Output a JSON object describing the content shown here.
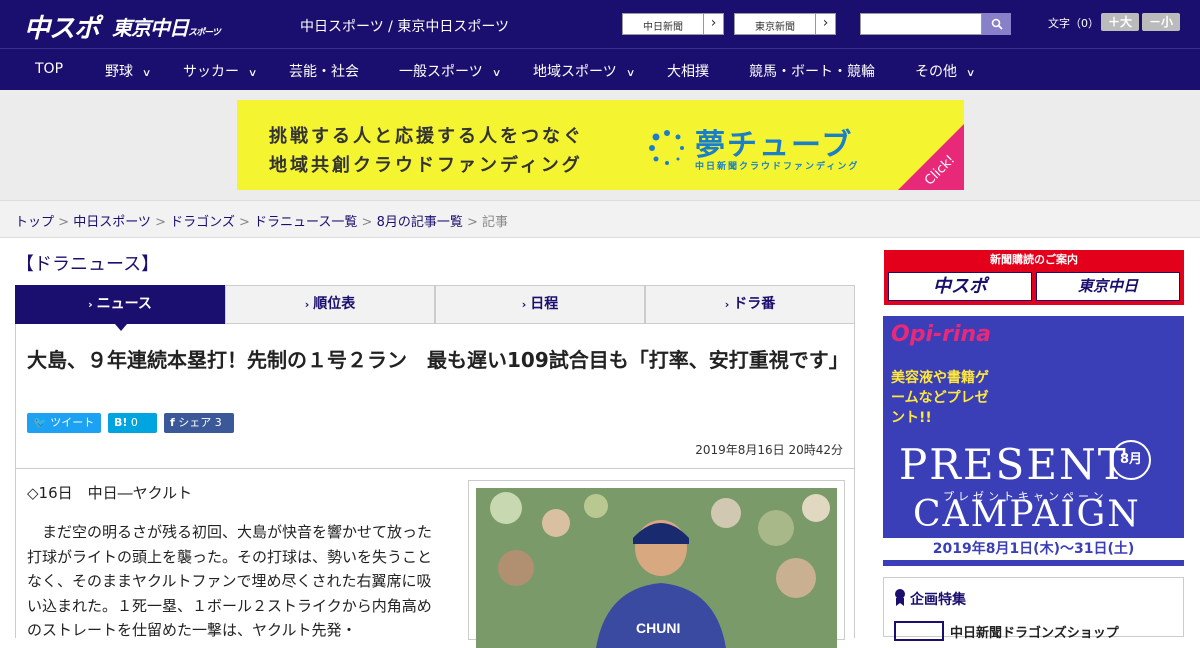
{
  "header": {
    "logo_chuspo": "中スポ",
    "logo_tokyo": "東京中日",
    "logo_tokyo_small": "スポーツ",
    "site_links": "中日スポーツ / 東京中日スポーツ",
    "paper_btn_1": "中日新聞",
    "paper_btn_2": "東京新聞",
    "search_placeholder": "",
    "font_label": "文字（0）",
    "font_plus": "＋大",
    "font_minus": "－小"
  },
  "nav": {
    "items": [
      {
        "label": "TOP"
      },
      {
        "label": "野球"
      },
      {
        "label": "サッカー"
      },
      {
        "label": "芸能・社会"
      },
      {
        "label": "一般スポーツ"
      },
      {
        "label": "地域スポーツ"
      },
      {
        "label": "大相撲"
      },
      {
        "label": "競馬・ボート・競輪"
      },
      {
        "label": "その他"
      }
    ]
  },
  "ad": {
    "line1": "挑戦する人と応援する人をつなぐ",
    "line2": "地域共創クラウドファンディング",
    "brand": "夢チューブ",
    "brand_sub": "中日新聞クラウドファンディング",
    "click": "Click!"
  },
  "breadcrumb": {
    "items": [
      "トップ",
      "中日スポーツ",
      "ドラゴンズ",
      "ドラニュース一覧",
      "8月の記事一覧"
    ],
    "current": "記事"
  },
  "category_title": "【ドラニュース】",
  "tabs": [
    {
      "label": "ニュース"
    },
    {
      "label": "順位表"
    },
    {
      "label": "日程"
    },
    {
      "label": "ドラ番"
    }
  ],
  "article": {
    "headline": "大島、９年連続本塁打！先制の１号２ラン　最も遅い109試合目も「打率、安打重視です」",
    "share_tweet": "ツイート",
    "share_hatena": "B!",
    "share_hatena_count": "0",
    "share_fb": "シェア",
    "share_fb_count": "3",
    "date": "2019年8月16日 20時42分",
    "game": "◇16日　中日―ヤクルト",
    "body": "　まだ空の明るさが残る初回、大島が快音を響かせて放った打球がライトの頭上を襲った。その打球は、勢いを失うことなく、そのままヤクルトファンで埋め尽くされた右翼席に吸い込まれた。１死一塁、１ボール２ストライクから内角高めのストレートを仕留めた一撃は、ヤクルト先発・"
  },
  "sidebar": {
    "subscribe_title": "新聞購読のご案内",
    "subscribe_1": "中スポ",
    "subscribe_2": "東京中日",
    "campaign_brand": "Opi-rina",
    "campaign_promo": "美容液や書籍ゲームなどプレゼント!!",
    "campaign_month": "8月",
    "campaign_present": "PRESENT",
    "campaign_sub": "プレゼントキャンペーン",
    "campaign_campaign": "CAMPAIGN",
    "campaign_dates": "2019年8月1日(木)～31日(土)",
    "feature_title": "企画特集",
    "feature_item": "中日新聞ドラゴンズショップ"
  },
  "colors": {
    "brand_navy": "#1a0f6e",
    "ad_yellow": "#f4f530",
    "accent_pink": "#e8297a",
    "twitter": "#1da1f2",
    "hatena": "#00a4de",
    "facebook": "#3b5998"
  }
}
